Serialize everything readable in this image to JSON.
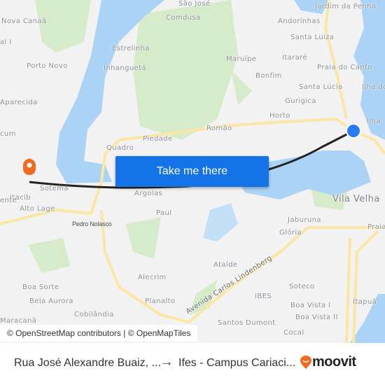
{
  "map": {
    "labels": {
      "sao_jose": "São José",
      "comdusa": "Comdusa",
      "nova_canaa": "Nova Canaã",
      "al_i": "al I",
      "porto_novo": "Porto Novo",
      "estrelinha": "Estrelinha",
      "inhangueta": "Inhanguetá",
      "aparecida": "Aparecida",
      "cum": "cum",
      "piedade": "Piedade",
      "quadro": "Quadro",
      "romao": "Romão",
      "horto": "Horto",
      "gurigica": "Gurigica",
      "santa_lucia": "Santa Lúcia",
      "praia_do_canto": "Praia do Canto",
      "bonfim": "Bonfim",
      "itarare": "Itararé",
      "maruipe": "Maruípe",
      "santa_luiza": "Santa Luiza",
      "andorinhas": "Andorinhas",
      "jardim_da_penha": "Jardim da Penha",
      "ilha_do": "Ilha do",
      "ilha": "Ilha",
      "itacib": "Itacib",
      "sotema": "Sotema",
      "ente": "ente",
      "alto_lage": "Alto Lage",
      "pedro_nolasco": "Pedro Nolasco",
      "argolas": "Argolas",
      "paul": "Paul",
      "alecrim": "Alecrim",
      "boa_sorte": "Boa Sorte",
      "bela_aurora": "Bela Aurora",
      "cobilandia": "Cobilândia",
      "maracana": "Maracanã",
      "planalto": "Planalto",
      "vila_velha": "Vila Velha",
      "jaburuna": "Jaburuna",
      "gloria": "Glória",
      "praia": "Praia",
      "ataide": "Ataíde",
      "av_carlos_lindenberg": "Avenida Carlos Lindenberg",
      "soteco": "Soteco",
      "ibes": "IBES",
      "boa_vista_i": "Boa Vista I",
      "boa_vista_ii": "Boa Vista II",
      "itapua": "Itapuã",
      "santos_dumont": "Santos Dumont",
      "cocal": "Cocal"
    },
    "cta_label": "Take me there",
    "attribution": "© OpenStreetMap contributors | © OpenMapTiles",
    "colors": {
      "water": "#aad3f5",
      "park": "#cfe8c0",
      "road": "#fbe7a3",
      "route": "#222222",
      "origin": "#f26a21",
      "destination": "#2b7bf0",
      "button": "#1473e6"
    }
  },
  "footer": {
    "from": "Rua José Alexandre Buaiz, ...",
    "arrow": "→",
    "to": "Ifes - Campus Cariaci...",
    "brand": "moovit"
  }
}
